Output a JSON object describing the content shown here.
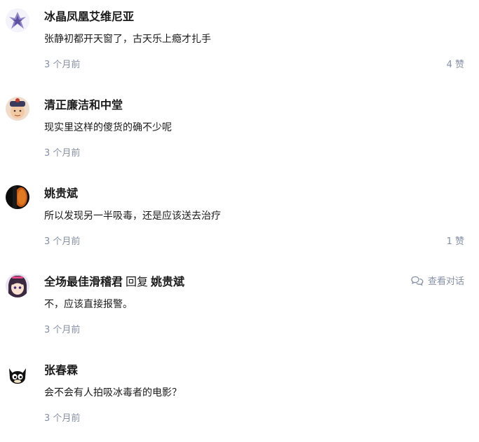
{
  "comments": [
    {
      "author": "冰晶凤凰艾维尼亚",
      "text": "张静初都开天窗了，古天乐上瘾才扎手",
      "time": "3 个月前",
      "likes": "4 赞",
      "avatar": "avatar-ice-phoenix"
    },
    {
      "author": "清正廉洁和中堂",
      "text": "现实里这样的傻货的确不少呢",
      "time": "3 个月前",
      "likes": "",
      "avatar": "avatar-qing-official"
    },
    {
      "author": "姚贵斌",
      "text": "所以发现另一半吸毒，还是应该送去治疗",
      "time": "3 个月前",
      "likes": "1 赞",
      "avatar": "avatar-dark-orange"
    },
    {
      "author": "全场最佳滑稽君",
      "reply_word": "回复",
      "reply_to": "姚贵斌",
      "view_conversation": "查看对话",
      "text": "不，应该直接报警。",
      "time": "3 个月前",
      "likes": "",
      "avatar": "avatar-anime-girl"
    },
    {
      "author": "张春霖",
      "text": "会不会有人拍吸冰毒者的电影？",
      "time": "3 个月前",
      "likes": "",
      "avatar": "avatar-black-cat"
    }
  ],
  "colors": {
    "meta": "#8590a6",
    "text": "#1a1a1a"
  }
}
